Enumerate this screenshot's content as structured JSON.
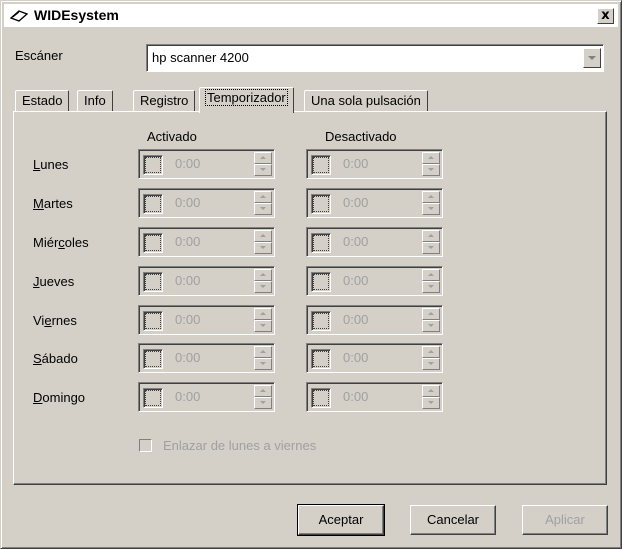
{
  "window": {
    "title": "WIDEsystem",
    "close_label": "x"
  },
  "scanner": {
    "label": "Escáner",
    "selected": "hp scanner 4200"
  },
  "tabs": [
    {
      "label": "Estado"
    },
    {
      "label": "Info"
    },
    {
      "label": "Registro"
    },
    {
      "label": "Temporizador",
      "active": true
    },
    {
      "label": "Una sola pulsación"
    }
  ],
  "schedule": {
    "col_on": "Activado",
    "col_off": "Desactivado",
    "days": [
      {
        "key": "L",
        "rest": "unes",
        "on": "0:00",
        "off": "0:00"
      },
      {
        "key": "M",
        "rest": "artes",
        "on": "0:00",
        "off": "0:00"
      },
      {
        "pre": "Miér",
        "key": "c",
        "rest": "oles",
        "on": "0:00",
        "off": "0:00"
      },
      {
        "key": "J",
        "rest": "ueves",
        "on": "0:00",
        "off": "0:00"
      },
      {
        "pre": "Vi",
        "key": "e",
        "rest": "rnes",
        "on": "0:00",
        "off": "0:00"
      },
      {
        "key": "S",
        "rest": "ábado",
        "on": "0:00",
        "off": "0:00"
      },
      {
        "key": "D",
        "rest": "omingo",
        "on": "0:00",
        "off": "0:00"
      }
    ],
    "link_label": "Enlazar de lunes a viernes"
  },
  "buttons": {
    "ok": "Aceptar",
    "cancel": "Cancelar",
    "apply": "Aplicar"
  }
}
